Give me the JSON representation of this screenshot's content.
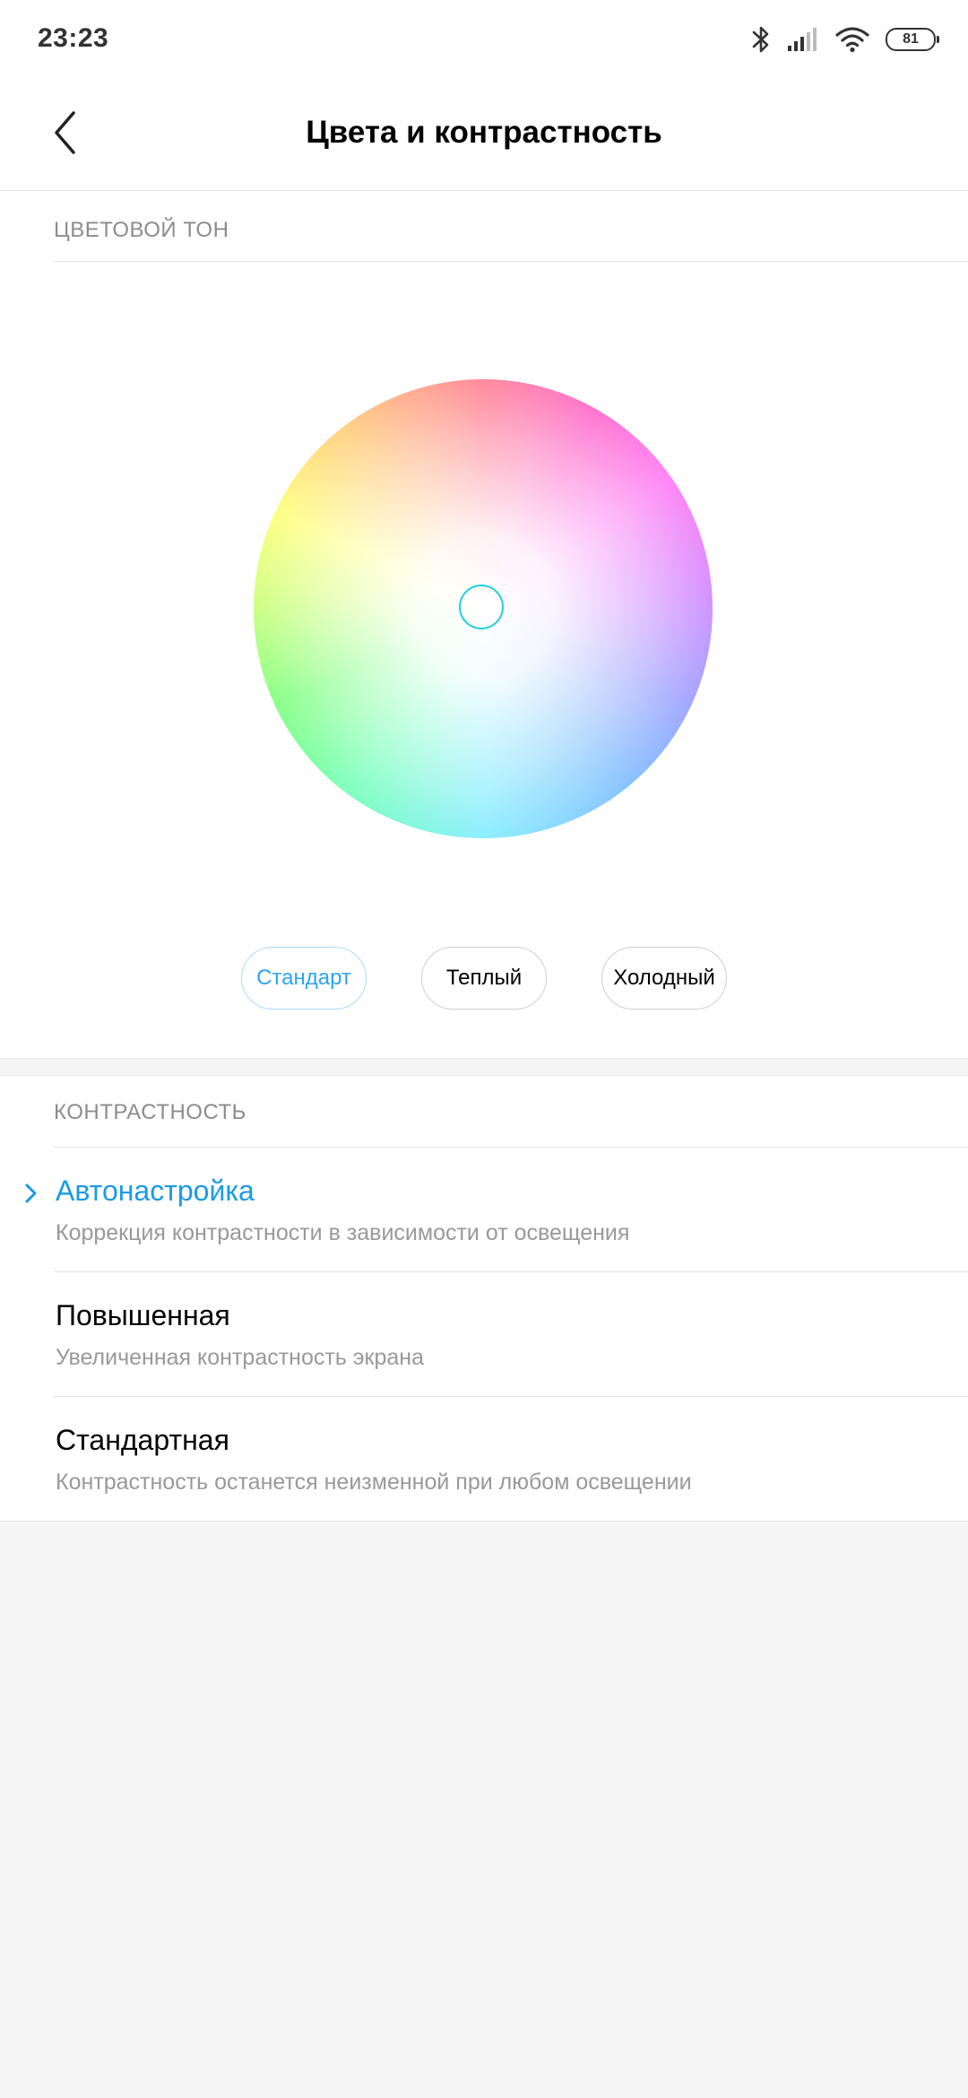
{
  "status_bar": {
    "time": "23:23",
    "battery_level": "81",
    "icons": [
      "bluetooth-icon",
      "signal-icon",
      "wifi-icon",
      "battery-icon"
    ]
  },
  "header": {
    "title": "Цвета и контрастность",
    "back_icon": "chevron-left-icon"
  },
  "color_tone": {
    "label": "ЦВЕТОВОЙ ТОН",
    "presets": [
      {
        "label": "Стандарт",
        "selected": true
      },
      {
        "label": "Теплый",
        "selected": false
      },
      {
        "label": "Холодный",
        "selected": false
      }
    ]
  },
  "contrast": {
    "label": "КОНТРАСТНОСТЬ",
    "options": [
      {
        "title": "Автонастройка",
        "subtitle": "Коррекция контрастности в зависимости от освещения",
        "selected": true
      },
      {
        "title": "Повышенная",
        "subtitle": "Увеличенная контрастность экрана",
        "selected": false
      },
      {
        "title": "Стандартная",
        "subtitle": "Контрастность останется неизменной при любом освещении",
        "selected": false
      }
    ]
  },
  "colors": {
    "accent": "#1a9ae6",
    "selected_border": "#a8dcfb",
    "page_background": "#f5f5f5",
    "cursor": "#1fd0e0"
  }
}
